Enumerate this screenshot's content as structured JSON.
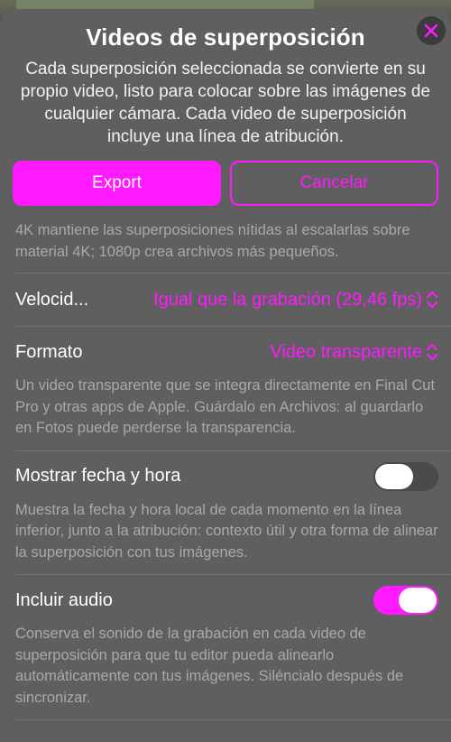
{
  "header": {
    "title": "Videos de superposición",
    "subtitle": "Cada superposición seleccionada se convierte en su propio video, listo para colocar sobre las imágenes de cualquier cámara. Cada video de superposición incluye una línea de atribución."
  },
  "actions": {
    "export_label": "Export",
    "cancel_label": "Cancelar"
  },
  "resolution": {
    "description": "4K mantiene las superposiciones nítidas al escalarlas sobre material 4K; 1080p crea archivos más pequeños."
  },
  "speed": {
    "label": "Velocid...",
    "value": "Igual que la grabación (29,46 fps)"
  },
  "format": {
    "label": "Formato",
    "value": "Video transparente",
    "description": "Un video transparente que se integra directamente en Final Cut Pro y otras apps de Apple. Guárdalo en Archivos: al guardarlo en Fotos puede perderse la transparencia."
  },
  "datetime": {
    "label": "Mostrar fecha y hora",
    "enabled": false,
    "description": "Muestra la fecha y hora local de cada momento en la línea inferior, junto a la atribución: contexto útil y otra forma de alinear la superposición con tus imágenes."
  },
  "audio": {
    "label": "Incluir audio",
    "enabled": true,
    "description": "Conserva el sonido de la grabación en cada video de superposición para que tu editor pueda alinearlo automáticamente con tus imágenes. Siléncialo después de sincronizar."
  },
  "colors": {
    "accent": "#ff1aff",
    "sheet": "#5f5f5f",
    "secondary_text": "#a9a9a9"
  }
}
